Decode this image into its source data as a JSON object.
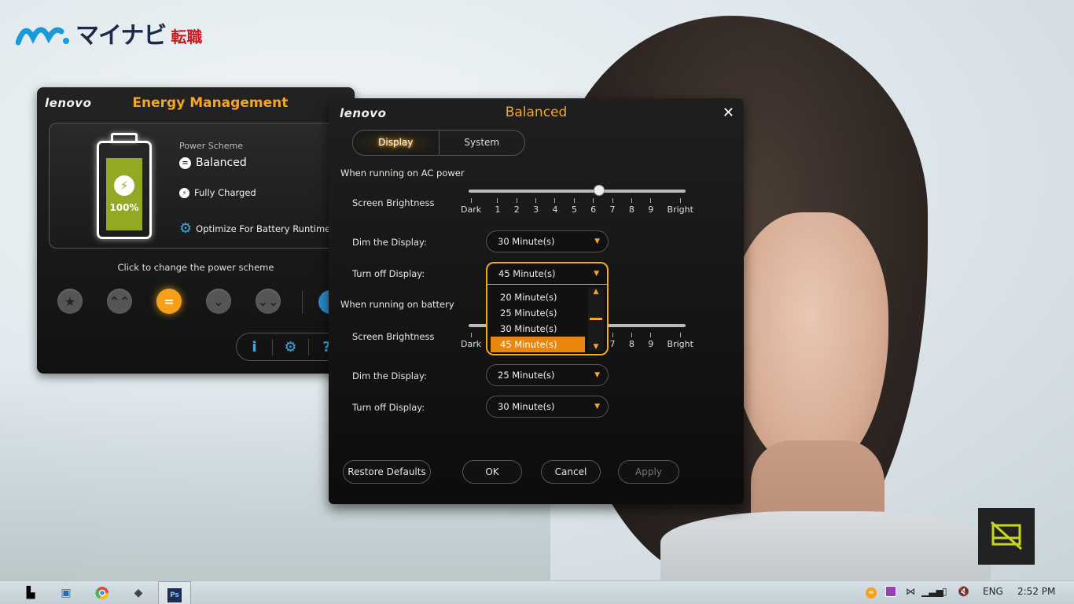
{
  "logo": {
    "brand": "マイナビ",
    "suffix": "転職"
  },
  "energy_window": {
    "lenovo": "lenovo",
    "title": "Energy Management",
    "battery_percent": "100%",
    "power_scheme_label": "Power Scheme",
    "power_scheme_value": "Balanced",
    "charge_status": "Fully Charged",
    "optimize_link": "Optimize For Battery Runtime",
    "click_label": "Click to change the power scheme",
    "scheme_buttons": [
      "★",
      "⌃⌃",
      "=",
      "⌄",
      "⌄⌄"
    ],
    "tools": [
      "i",
      "⚙",
      "?"
    ]
  },
  "dialog": {
    "lenovo": "lenovo",
    "title": "Balanced",
    "close": "✕",
    "tabs": [
      "Display",
      "System"
    ],
    "ac": {
      "section": "When running on AC power",
      "brightness_label": "Screen Brightness",
      "brightness_level": 6,
      "dim_label": "Dim the Display:",
      "dim_value": "30 Minute(s)",
      "off_label": "Turn off Display:",
      "off_value": "45 Minute(s)"
    },
    "battery": {
      "section": "When running on battery",
      "brightness_label": "Screen Brightness",
      "dim_label": "Dim the Display:",
      "dim_value": "25 Minute(s)",
      "off_label": "Turn off Display:",
      "off_value": "30 Minute(s)"
    },
    "ticks": [
      "Dark",
      "1",
      "2",
      "3",
      "4",
      "5",
      "6",
      "7",
      "8",
      "9",
      "Bright"
    ],
    "dropdown_options": [
      "20 Minute(s)",
      "25 Minute(s)",
      "30 Minute(s)",
      "45 Minute(s)"
    ],
    "buttons": {
      "restore": "Restore Defaults",
      "ok": "OK",
      "cancel": "Cancel",
      "apply": "Apply"
    }
  },
  "taskbar": {
    "lang": "ENG",
    "time": "2:52 PM",
    "ps_label": "Ps"
  },
  "colors": {
    "accent": "#f5a623",
    "battery_fill": "#95a824",
    "link_blue": "#3aa9e6"
  }
}
